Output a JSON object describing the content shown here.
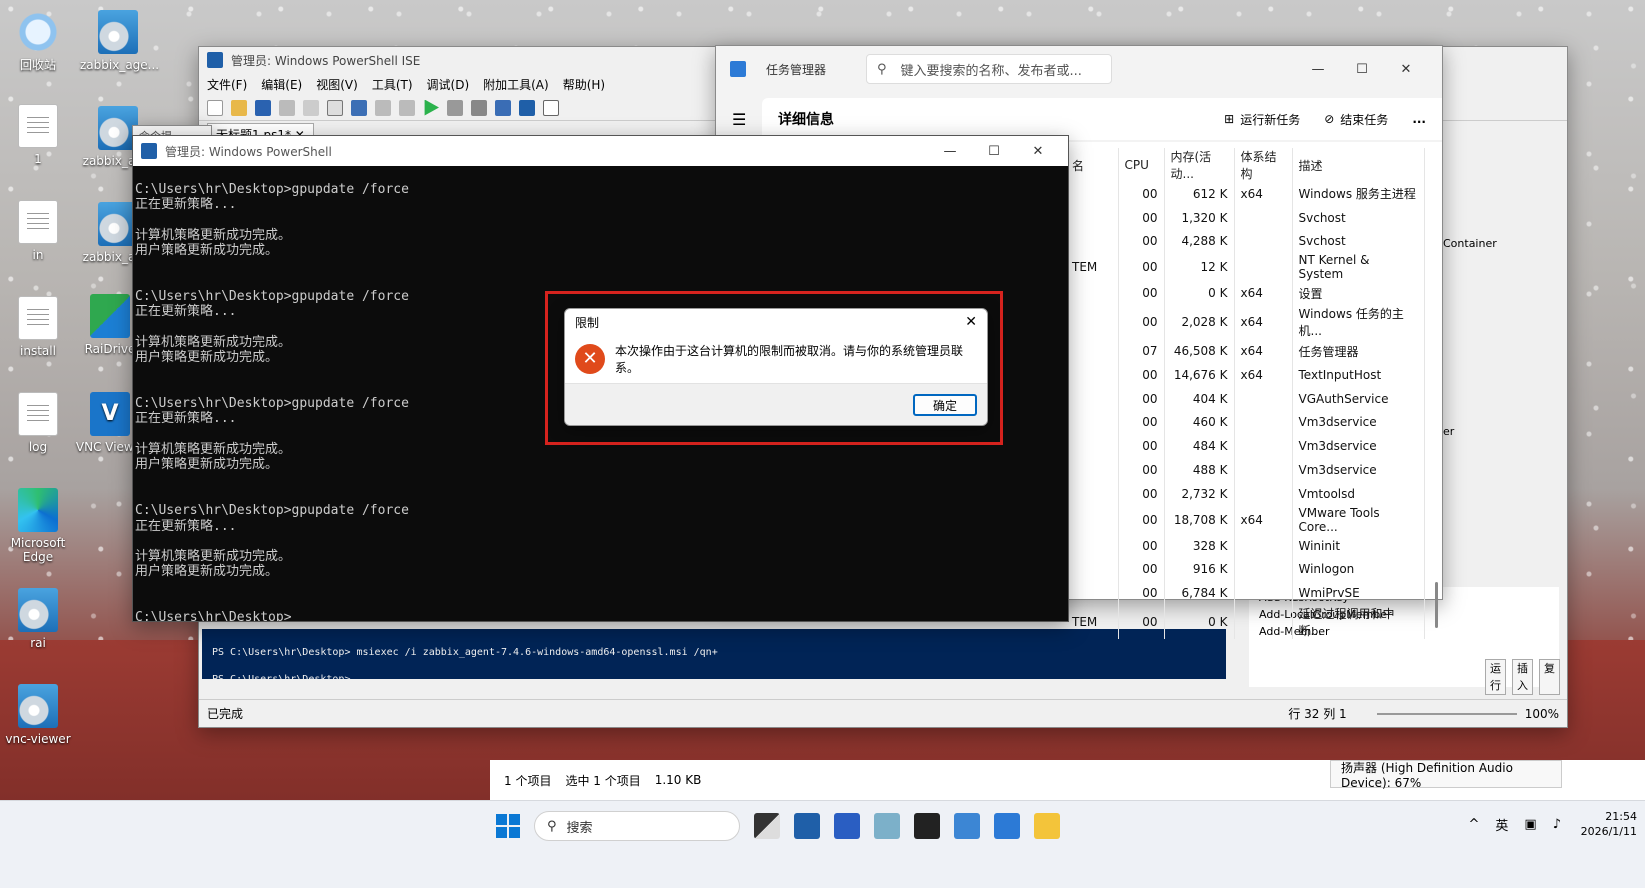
{
  "desktop": {
    "icons": [
      {
        "label": "回收站"
      },
      {
        "label": "zabbix_age..."
      },
      {
        "label": "1"
      },
      {
        "label": "zabbix_ac..."
      },
      {
        "label": "in"
      },
      {
        "label": "zabbix_ac..."
      },
      {
        "label": "install"
      },
      {
        "label": "RaiDrive"
      },
      {
        "label": "log"
      },
      {
        "label": "VNC View..."
      },
      {
        "label": "Microsoft Edge"
      },
      {
        "label": "rai"
      },
      {
        "label": "vnc-viewer"
      }
    ]
  },
  "ise": {
    "title": "管理员: Windows PowerShell ISE",
    "menu": [
      "文件(F)",
      "编辑(E)",
      "视图(V)",
      "工具(T)",
      "调试(D)",
      "附加工具(A)",
      "帮助(H)"
    ],
    "tab": "无标题1.ps1*",
    "console_lines": [
      "PS C:\\Users\\hr\\Desktop> msiexec /i zabbix_agent-7.4.6-windows-amd64-openssl.msi /qn+",
      "PS C:\\Users\\hr\\Desktop>"
    ],
    "status": "已完成",
    "position": "行 32  列 1",
    "zoom": "100%",
    "cmd_list": [
      "Add-KdsRootKey",
      "Add-LocalGroupMember",
      "Add-Member"
    ],
    "bottom_buttons": [
      "运行",
      "插入",
      "复"
    ],
    "side_text": [
      "Container",
      "er"
    ]
  },
  "taskmgr": {
    "title": "任务管理器",
    "search_placeholder": "键入要搜索的名称、发布者或...",
    "section": "详细信息",
    "run_new": "运行新任务",
    "end_task": "结束任务",
    "more": "...",
    "columns": [
      "名",
      "CPU",
      "内存(活动...",
      "体系结构",
      "描述"
    ],
    "rows": [
      {
        "user": "",
        "cpu": "00",
        "mem": "612 K",
        "arch": "x64",
        "desc": "Windows 服务主进程"
      },
      {
        "user": "",
        "cpu": "00",
        "mem": "1,320 K",
        "arch": "",
        "desc": "Svchost"
      },
      {
        "user": "",
        "cpu": "00",
        "mem": "4,288 K",
        "arch": "",
        "desc": "Svchost"
      },
      {
        "user": "TEM",
        "cpu": "00",
        "mem": "12 K",
        "arch": "",
        "desc": "NT Kernel & System"
      },
      {
        "user": "",
        "cpu": "00",
        "mem": "0 K",
        "arch": "x64",
        "desc": "设置"
      },
      {
        "user": "",
        "cpu": "00",
        "mem": "2,028 K",
        "arch": "x64",
        "desc": "Windows 任务的主机..."
      },
      {
        "user": "",
        "cpu": "07",
        "mem": "46,508 K",
        "arch": "x64",
        "desc": "任务管理器"
      },
      {
        "user": "",
        "cpu": "00",
        "mem": "14,676 K",
        "arch": "x64",
        "desc": "TextInputHost"
      },
      {
        "user": "",
        "cpu": "00",
        "mem": "404 K",
        "arch": "",
        "desc": "VGAuthService"
      },
      {
        "user": "",
        "cpu": "00",
        "mem": "460 K",
        "arch": "",
        "desc": "Vm3dservice"
      },
      {
        "user": "",
        "cpu": "00",
        "mem": "484 K",
        "arch": "",
        "desc": "Vm3dservice"
      },
      {
        "user": "",
        "cpu": "00",
        "mem": "488 K",
        "arch": "",
        "desc": "Vm3dservice"
      },
      {
        "user": "",
        "cpu": "00",
        "mem": "2,732 K",
        "arch": "",
        "desc": "Vmtoolsd"
      },
      {
        "user": "",
        "cpu": "00",
        "mem": "18,708 K",
        "arch": "x64",
        "desc": "VMware Tools Core..."
      },
      {
        "user": "",
        "cpu": "00",
        "mem": "328 K",
        "arch": "",
        "desc": "Wininit"
      },
      {
        "user": "",
        "cpu": "00",
        "mem": "916 K",
        "arch": "",
        "desc": "Winlogon"
      },
      {
        "user": "",
        "cpu": "00",
        "mem": "6,784 K",
        "arch": "",
        "desc": "WmiPrvSE"
      },
      {
        "user": "TEM",
        "cpu": "00",
        "mem": "0 K",
        "arch": "",
        "desc": "延迟过程调用和中断..."
      }
    ]
  },
  "console": {
    "title": "管理员: Windows PowerShell",
    "behind_title": "命令提",
    "text": "C:\\Users\\hr\\Desktop>gpupdate /force\n正在更新策略...\n\n计算机策略更新成功完成。\n用户策略更新成功完成。\n\n\nC:\\Users\\hr\\Desktop>gpupdate /force\n正在更新策略...\n\n计算机策略更新成功完成。\n用户策略更新成功完成。\n\n\nC:\\Users\\hr\\Desktop>gpupdate /force\n正在更新策略...\n\n计算机策略更新成功完成。\n用户策略更新成功完成。\n\n\nC:\\Users\\hr\\Desktop>gpupdate /force\n正在更新策略...\n\n计算机策略更新成功完成。\n用户策略更新成功完成。\n\n\nC:\\Users\\hr\\Desktop>"
  },
  "dialog": {
    "title": "限制",
    "message": "本次操作由于这台计算机的限制而被取消。请与你的系统管理员联系。",
    "ok": "确定",
    "highlight_color": "#d6231e"
  },
  "explorer": {
    "count": "1 个项目",
    "selected": "选中 1 个项目",
    "size": "1.10 KB"
  },
  "tooltip": "扬声器 (High Definition Audio Device): 67%",
  "taskbar": {
    "search": "搜索",
    "ime": "英",
    "time": "21:54",
    "date": "2026/1/11"
  }
}
